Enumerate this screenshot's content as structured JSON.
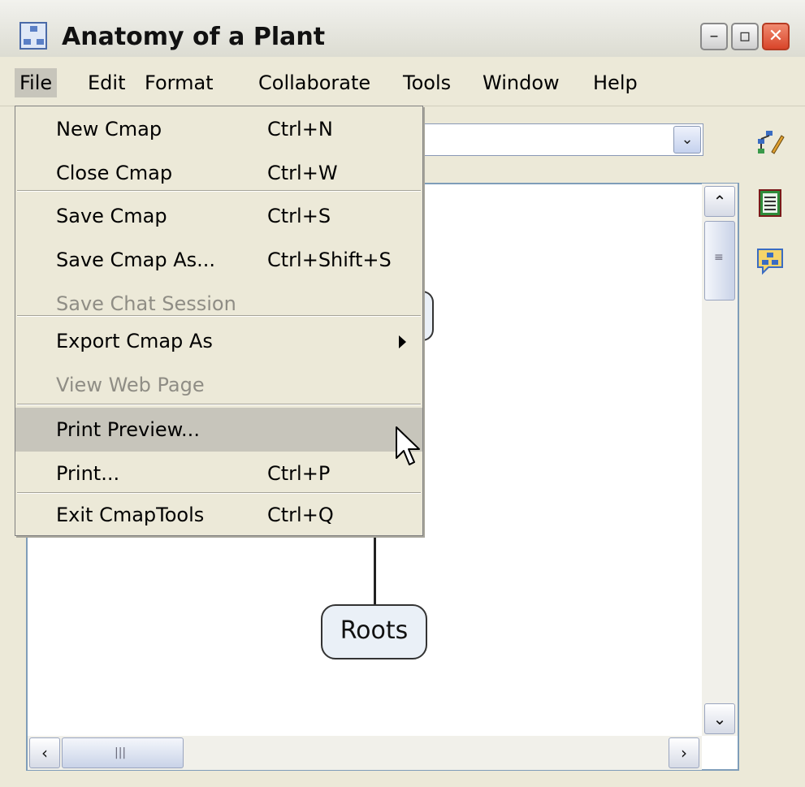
{
  "window": {
    "title": "Anatomy of a Plant"
  },
  "menubar": [
    {
      "label": "File",
      "active": true
    },
    {
      "label": "Edit"
    },
    {
      "label": "Format"
    },
    {
      "label": "Collaborate"
    },
    {
      "label": "Tools"
    },
    {
      "label": "Window"
    },
    {
      "label": "Help"
    }
  ],
  "file_menu": {
    "items": [
      {
        "label": "New Cmap",
        "shortcut": "Ctrl+N"
      },
      {
        "label": "Close Cmap",
        "shortcut": "Ctrl+W"
      },
      {
        "label": "Save Cmap",
        "shortcut": "Ctrl+S"
      },
      {
        "label": "Save Cmap As...",
        "shortcut": "Ctrl+Shift+S"
      },
      {
        "label": "Save Chat Session",
        "disabled": true
      },
      {
        "label": "Export Cmap As",
        "submenu": true
      },
      {
        "label": "View Web Page",
        "disabled": true
      },
      {
        "label": "Print Preview...",
        "highlighted": true
      },
      {
        "label": "Print...",
        "shortcut": "Ctrl+P"
      },
      {
        "label": "Exit CmapTools",
        "shortcut": "Ctrl+Q"
      }
    ]
  },
  "canvas": {
    "nodes": [
      {
        "label": "Roots"
      }
    ]
  },
  "icons": {
    "app": "concept-map-app-icon",
    "side": [
      "edit-cmap-icon",
      "view-list-icon",
      "chat-cmap-icon"
    ]
  },
  "colors": {
    "menu_bg": "#ece9d8",
    "highlight": "#c7c5bb",
    "node_fill": "#eaf0f7"
  }
}
